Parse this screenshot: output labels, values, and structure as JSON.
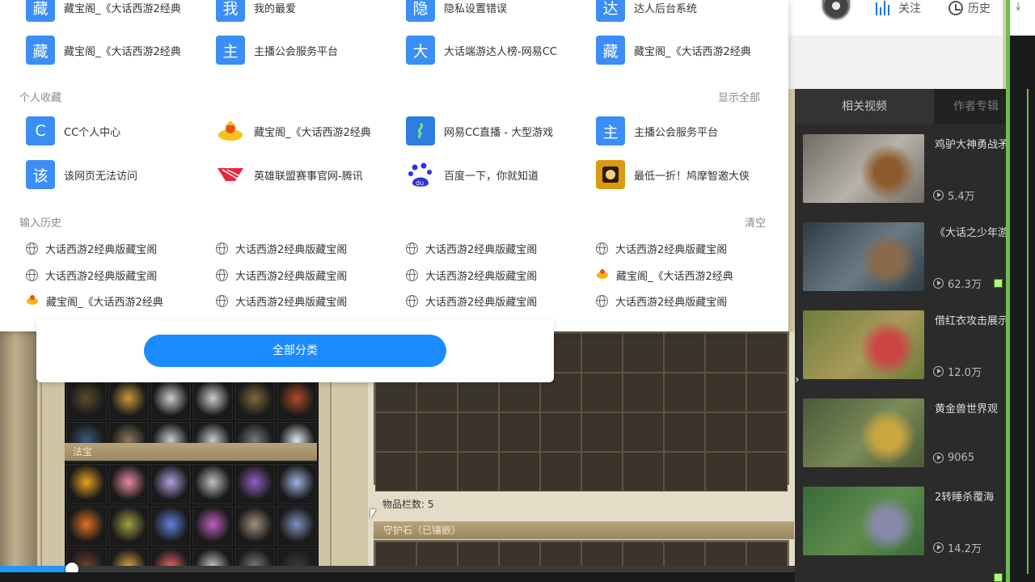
{
  "top_sites": [
    {
      "label": "藏宝阁_《大话西游2经典",
      "glyph": "藏",
      "color": "#3a8ef6"
    },
    {
      "label": "我的最爱",
      "glyph": "我",
      "color": "#3a8ef6"
    },
    {
      "label": "隐私设置错误",
      "glyph": "隐",
      "color": "#3a8ef6"
    },
    {
      "label": "达人后台系统",
      "glyph": "达",
      "color": "#3a8ef6"
    },
    {
      "label": "藏宝阁_《大话西游2经典",
      "glyph": "藏",
      "color": "#3a8ef6"
    },
    {
      "label": "主播公会服务平台",
      "glyph": "主",
      "color": "#3a8ef6"
    },
    {
      "label": "大话端游达人榜-网易CC",
      "glyph": "大",
      "color": "#3a8ef6"
    },
    {
      "label": "藏宝阁_《大话西游2经典",
      "glyph": "藏",
      "color": "#3a8ef6"
    }
  ],
  "favorites": {
    "title": "个人收藏",
    "action": "显示全部",
    "items": [
      {
        "label": "CC个人中心",
        "glyph": "C",
        "color": "#3a8ef6",
        "icon": "letter"
      },
      {
        "label": "藏宝阁_《大话西游2经典",
        "glyph": "",
        "color": "#ffffff",
        "icon": "treasure-icon"
      },
      {
        "label": "网易CC直播 - 大型游戏",
        "glyph": "",
        "color": "#2e7de0",
        "icon": "cc-live-icon"
      },
      {
        "label": "主播公会服务平台",
        "glyph": "主",
        "color": "#3a8ef6",
        "icon": "letter"
      },
      {
        "label": "该网页无法访问",
        "glyph": "该",
        "color": "#3a8ef6",
        "icon": "letter"
      },
      {
        "label": "英雄联盟赛事官网-腾讯",
        "glyph": "",
        "color": "#ffffff",
        "icon": "lol-icon"
      },
      {
        "label": "百度一下，你就知道",
        "glyph": "",
        "color": "#ffffff",
        "icon": "baidu-icon"
      },
      {
        "label": "最低一折！鸠摩智邀大侠",
        "glyph": "",
        "color": "#d89a10",
        "icon": "game-promo-icon"
      }
    ]
  },
  "history": {
    "title": "输入历史",
    "action": "清空",
    "items": [
      {
        "label": "大话西游2经典版藏宝阁",
        "icon": "globe-icon"
      },
      {
        "label": "大话西游2经典版藏宝阁",
        "icon": "globe-icon"
      },
      {
        "label": "大话西游2经典版藏宝阁",
        "icon": "globe-icon"
      },
      {
        "label": "大话西游2经典版藏宝阁",
        "icon": "globe-icon"
      },
      {
        "label": "大话西游2经典版藏宝阁",
        "icon": "globe-icon"
      },
      {
        "label": "大话西游2经典版藏宝阁",
        "icon": "globe-icon"
      },
      {
        "label": "大话西游2经典版藏宝阁",
        "icon": "globe-icon"
      },
      {
        "label": "藏宝阁_《大话西游2经典",
        "icon": "duck-icon"
      },
      {
        "label": "藏宝阁_《大话西游2经典",
        "icon": "duck-icon"
      },
      {
        "label": "大话西游2经典版藏宝阁",
        "icon": "globe-icon"
      },
      {
        "label": "大话西游2经典版藏宝阁",
        "icon": "globe-icon"
      },
      {
        "label": "大话西游2经典版藏宝阁",
        "icon": "globe-icon"
      }
    ]
  },
  "category_button": "全部分类",
  "header": {
    "follow_label": "关注",
    "history_label": "历史",
    "accent": "#1b74e4"
  },
  "sidebar": {
    "tabs": [
      "相关视频",
      "作者专辑"
    ],
    "videos": [
      {
        "title": "鸡驴大神勇战矛发猪",
        "views": "5.4万",
        "palette": [
          "#6f6a62",
          "#b8b3aa",
          "#8c5a2b"
        ]
      },
      {
        "title": "《大话之少年游》剧",
        "views": "62.3万",
        "palette": [
          "#2e3b44",
          "#6a7a84",
          "#8a6a4a"
        ]
      },
      {
        "title": "借红衣攻击展示",
        "views": "12.0万",
        "palette": [
          "#6b7d3a",
          "#a89a5a",
          "#c44"
        ]
      },
      {
        "title": "黄金兽世界观",
        "views": "9065",
        "palette": [
          "#4a5a38",
          "#7a8a58",
          "#c9a640"
        ]
      },
      {
        "title": "2转睡杀覆海",
        "views": "14.2万",
        "palette": [
          "#3a6a3a",
          "#5d8d4d",
          "#88a"
        ]
      }
    ]
  },
  "game": {
    "fabao_label": "法宝",
    "item_count_label": "物品栏数: 5",
    "guard_stone_label": "守护石（已镶嵌）",
    "item_colors_top": [
      "#5a4a2a",
      "#c79a3a",
      "#ccc",
      "#ccc",
      "#7a6a3a",
      "#b04a2a",
      "#3a5a7a",
      "#8a7a5a",
      "#ccc",
      "#ccc",
      "#7a7a7a",
      "#dde7f0"
    ],
    "item_colors_fabao": [
      "#e8a020",
      "#e88aa0",
      "#b0a0e0",
      "#c0c0c0",
      "#9060c0",
      "#a0b0e0",
      "#e07020",
      "#a0a040",
      "#6080e0",
      "#c060c0",
      "#a09080",
      "#8090c0",
      "#704030",
      "#d0a040",
      "#e06060",
      "#c0c0c0",
      "#7a7a7a",
      "#3a3a3a"
    ]
  },
  "video_progress": 0.09
}
